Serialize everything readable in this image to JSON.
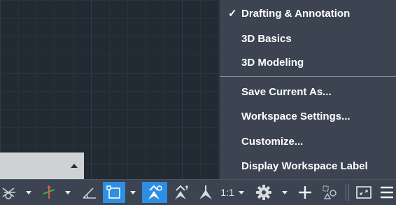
{
  "workspace_menu": {
    "checked_mark": "✓",
    "items": [
      {
        "label": "Drafting & Annotation",
        "checked": true
      },
      {
        "label": "3D Basics",
        "checked": false
      },
      {
        "label": "3D Modeling",
        "checked": false
      },
      {
        "label": "Save Current As...",
        "checked": false
      },
      {
        "label": "Workspace Settings...",
        "checked": false
      },
      {
        "label": "Customize...",
        "checked": false
      },
      {
        "label": "Display Workspace Label",
        "checked": false
      }
    ]
  },
  "status_bar": {
    "annotation_scale": "1:1",
    "icons": [
      "isodraft-icon",
      "dynamic-ucs-icon",
      "angle-icon",
      "selection-cycling-icon",
      "annotation-visibility-icon",
      "auto-scale-icon",
      "annotation-scale-icon",
      "workspace-gear-icon",
      "annotation-monitor-icon",
      "units-icon",
      "clean-screen-icon",
      "menu-icon"
    ]
  },
  "colors": {
    "canvas": "#222a33",
    "menu_bg": "#3b4450",
    "highlight": "#2d8fe3",
    "text": "#ffffff"
  }
}
